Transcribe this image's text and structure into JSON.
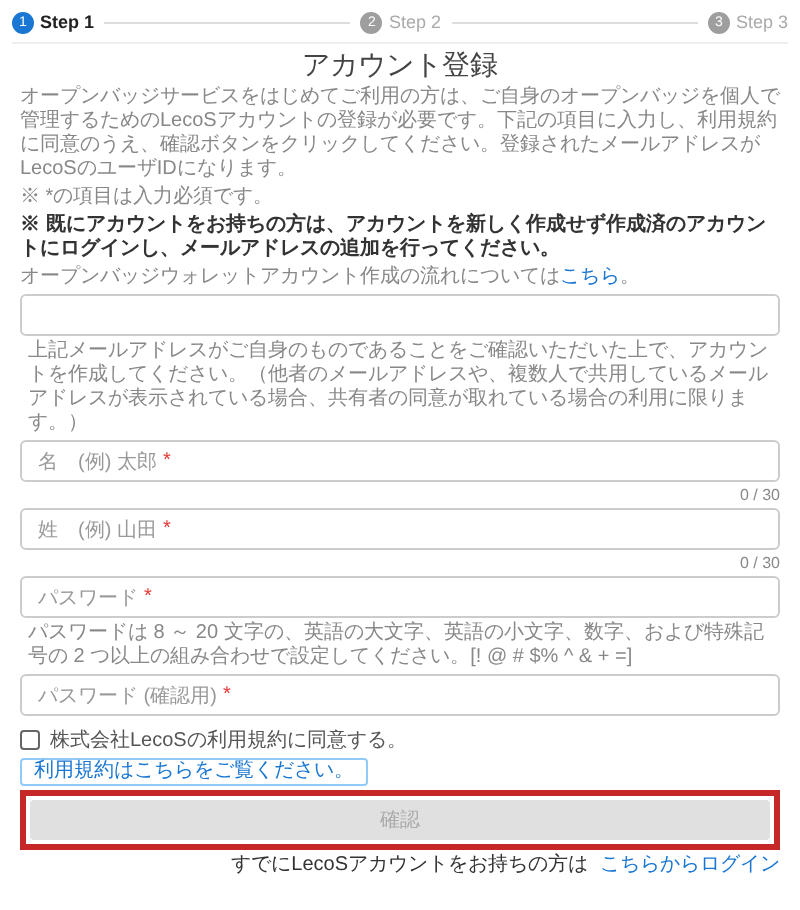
{
  "steps": [
    {
      "number": "1",
      "label": "Step 1",
      "selected": true
    },
    {
      "number": "2",
      "label": "Step 2",
      "selected": false
    },
    {
      "number": "3",
      "label": "Step 3",
      "selected": false
    }
  ],
  "title": "アカウント登録",
  "intro": "オープンバッジサービスをはじめてご利用の方は、ご自身のオープンバッジを個人で管理するためのLecoSアカウントの登録が必要です。下記の項目に入力し、利用規約に同意のうえ、確認ボタンをクリックしてください。登録されたメールアドレスがLecoSのユーザIDになります。",
  "notes": [
    {
      "text": "※ *の項目は入力必須です。",
      "bold": false
    },
    {
      "text": "※ 既にアカウントをお持ちの方は、アカウントを新しく作成せず作成済のアカウントにログインし、メールアドレスの追加を行ってください。",
      "bold": true
    }
  ],
  "flow": {
    "text": "オープンバッジウォレットアカウント作成の流れについては",
    "link": "こちら",
    "suffix": "。"
  },
  "fields": [
    {
      "hint": "上記メールアドレスがご自身のものであることをご確認いただいた上で、アカウントを作成してください。（他者のメールアドレスや、複数人で共用しているメールアドレスが表示されている場合、共有者の同意が取れている場合の利用に限ります。）"
    },
    {
      "label": "名　(例) 太郎",
      "required_mark": "*",
      "counter": "0 / 30"
    },
    {
      "label": "姓　(例) 山田",
      "required_mark": "*",
      "counter": "0 / 30"
    },
    {
      "label": "パスワード",
      "required_mark": "*",
      "hint": "パスワードは 8 ～ 20 文字の、英語の大文字、英語の小文字、数字、および特殊記号の 2 つ以上の組み合わせで設定してください。[! @ # $% ^ & + =]"
    },
    {
      "label": "パスワード (確認用)",
      "required_mark": "*"
    }
  ],
  "agree": {
    "label": "株式会社LecoSの利用規約に同意する。",
    "checked": false
  },
  "terms_button": "利用規約はこちらをご覧ください。",
  "confirm": {
    "label": "確認",
    "disabled": true
  },
  "login": {
    "text": "すでにLecoSアカウントをお持ちの方は",
    "link": "こちらからログイン"
  }
}
